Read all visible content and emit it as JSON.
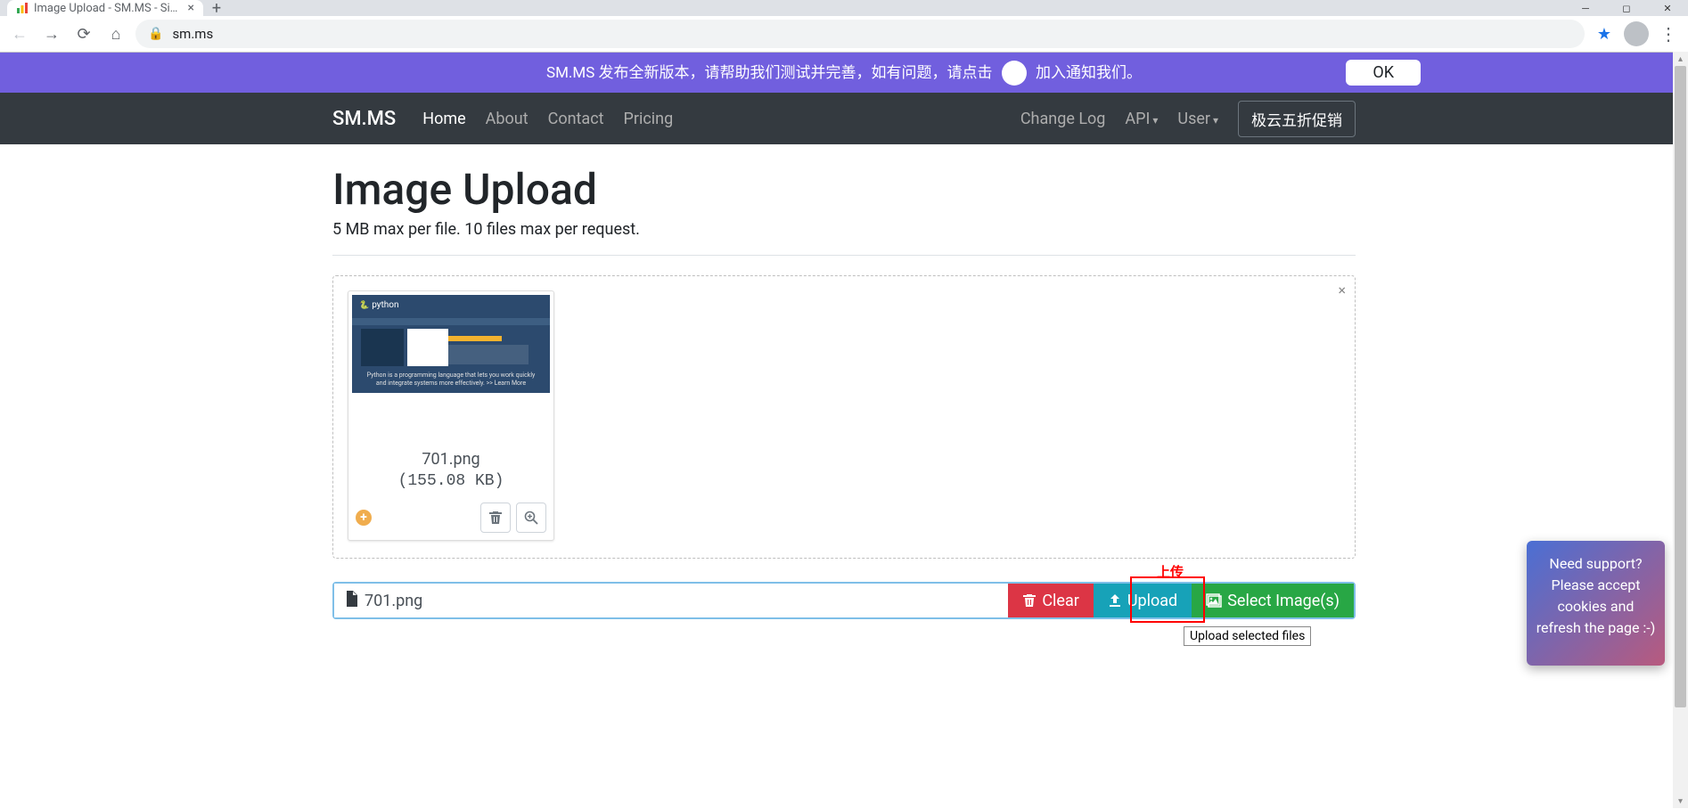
{
  "browser": {
    "tab_title": "Image Upload - SM.MS - Simp",
    "url": "sm.ms"
  },
  "banner": {
    "text_prefix": "SM.MS 发布全新版本，请帮助我们测试并完善，如有问题，请点击",
    "text_suffix": "加入通知我们。",
    "ok_label": "OK"
  },
  "navbar": {
    "brand": "SM.MS",
    "links": [
      "Home",
      "About",
      "Contact",
      "Pricing"
    ],
    "right_links": [
      "Change Log",
      "API",
      "User"
    ],
    "promo": "极云五折促销"
  },
  "page": {
    "title": "Image Upload",
    "subtitle": "5 MB max per file. 10 files max per request."
  },
  "file": {
    "name": "701.png",
    "size": "(155.08 KB)"
  },
  "input_row": {
    "filename": "701.png",
    "clear_label": "Clear",
    "upload_label": "Upload",
    "select_label": "Select Image(s)"
  },
  "annotations": {
    "upload_cn": "上传",
    "tooltip": "Upload selected files"
  },
  "support": {
    "text": "Need support? Please accept cookies and refresh the page :-)"
  }
}
